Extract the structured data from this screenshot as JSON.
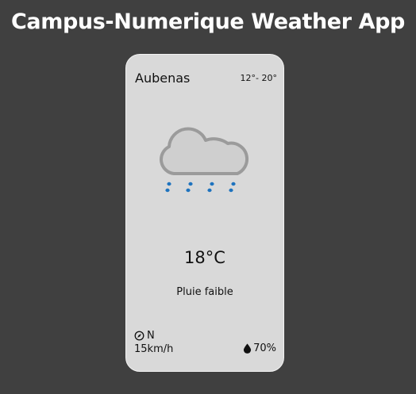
{
  "app": {
    "title": "Campus-Numerique Weather App"
  },
  "card": {
    "city": "Aubenas",
    "temp_range": "12°- 20°",
    "condition_icon": "light-rain-cloud-icon",
    "temperature": "18°C",
    "description": "Pluie faible",
    "wind": {
      "direction": "N",
      "speed": "15km/h",
      "icon": "compass-icon"
    },
    "humidity": {
      "value": "70%",
      "icon": "water-drop-icon"
    }
  },
  "colors": {
    "background": "#404040",
    "card": "#d9d9d9",
    "cloud": "#cfcfcf",
    "cloud_outline": "#9b9b9b",
    "rain": "#1e73be",
    "text": "#111111",
    "title": "#ffffff"
  }
}
